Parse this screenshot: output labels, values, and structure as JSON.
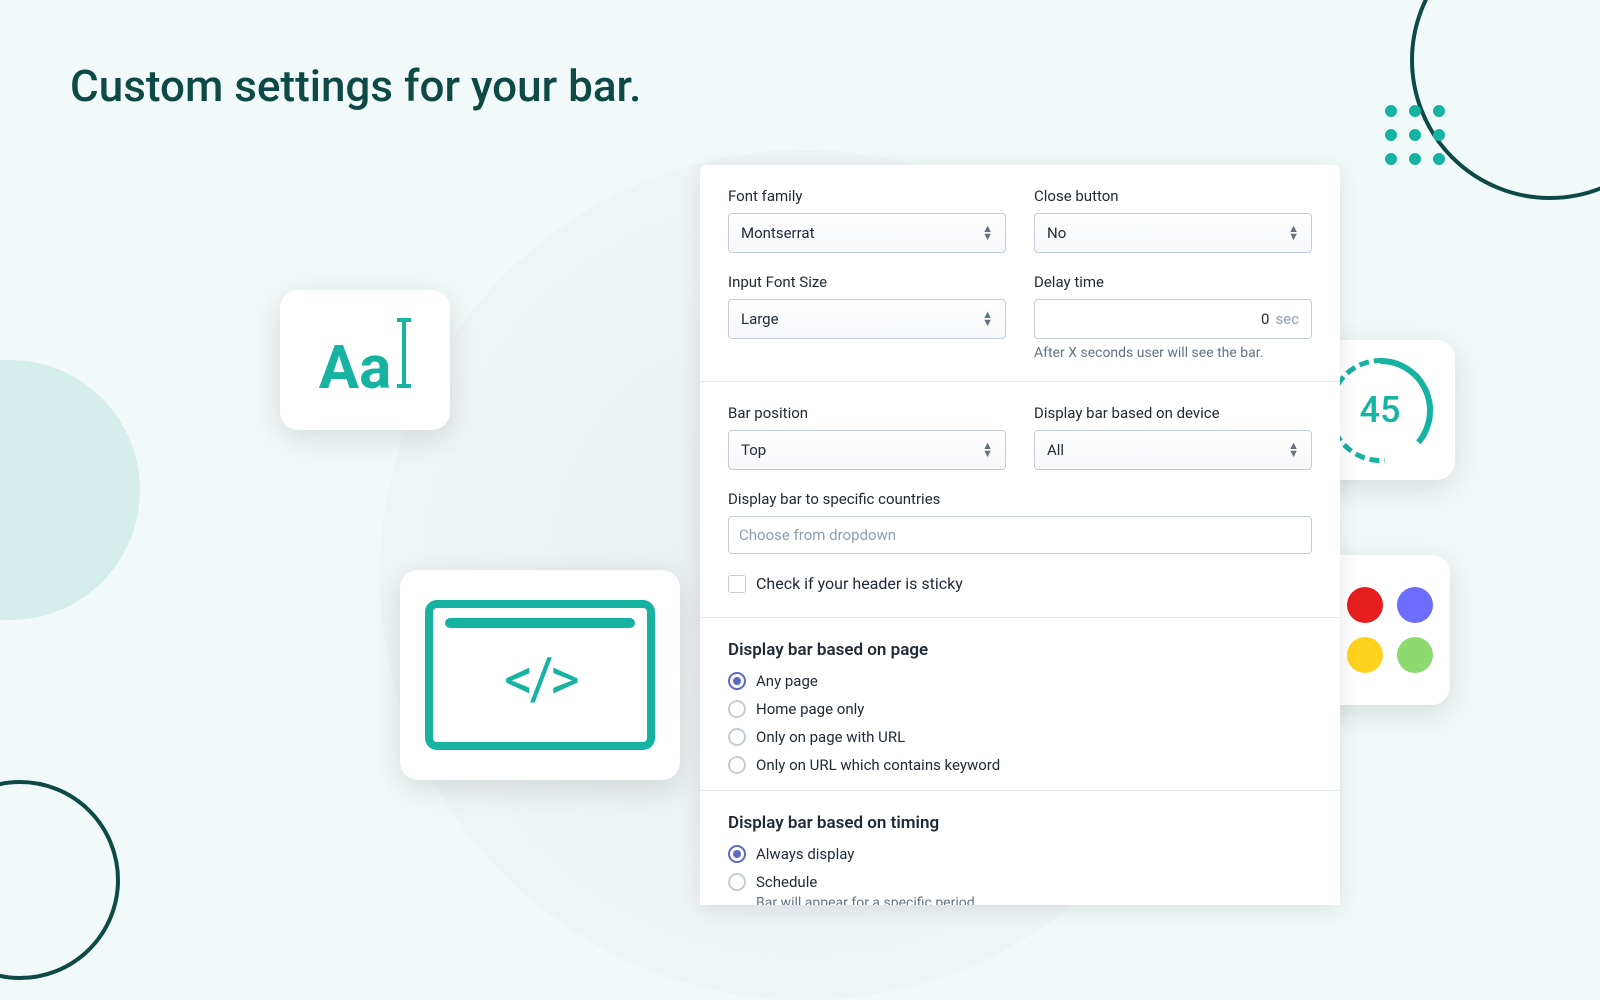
{
  "page_title": "Custom settings for your bar.",
  "timer_card_value": "45",
  "settings": {
    "font_family": {
      "label": "Font family",
      "value": "Montserrat"
    },
    "close_button": {
      "label": "Close button",
      "value": "No"
    },
    "input_font_size": {
      "label": "Input Font Size",
      "value": "Large"
    },
    "delay_time": {
      "label": "Delay time",
      "value": "0",
      "unit": "sec",
      "hint": "After X seconds user will see the bar."
    },
    "bar_position": {
      "label": "Bar position",
      "value": "Top"
    },
    "display_device": {
      "label": "Display bar based on device",
      "value": "All"
    },
    "countries": {
      "label": "Display bar to specific countries",
      "placeholder": "Choose from dropdown"
    },
    "sticky_check": {
      "label": "Check if your header is sticky"
    },
    "page_section": {
      "title": "Display bar based on page",
      "selected": 0,
      "options": [
        "Any page",
        "Home page only",
        "Only on page with URL",
        "Only on URL which contains keyword"
      ]
    },
    "timing_section": {
      "title": "Display bar based on timing",
      "selected": 0,
      "options": [
        "Always display",
        "Schedule"
      ],
      "schedule_hint": "Bar will appear for a specific period"
    }
  }
}
